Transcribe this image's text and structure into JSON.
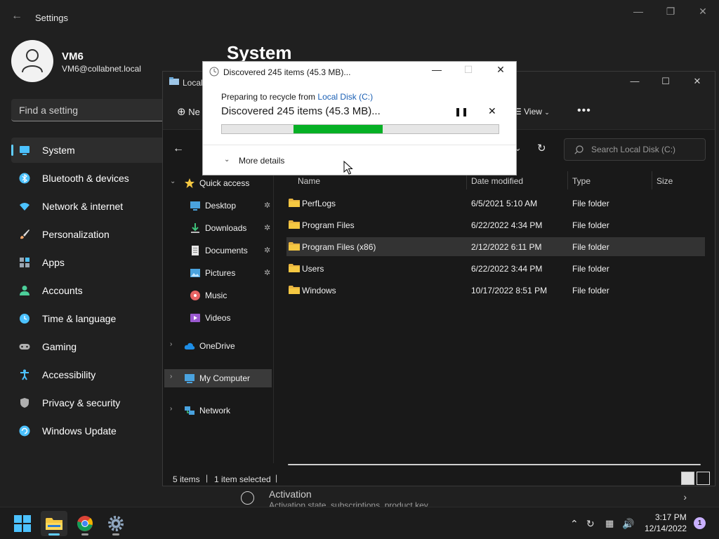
{
  "settings": {
    "title": "Settings",
    "user_name": "VM6",
    "user_email": "VM6@collabnet.local",
    "search_placeholder": "Find a setting",
    "page_heading": "System",
    "nav": [
      {
        "label": "System",
        "icon": "monitor-icon",
        "color": "#4cc2ff"
      },
      {
        "label": "Bluetooth & devices",
        "icon": "bluetooth-icon",
        "color": "#4cc2ff"
      },
      {
        "label": "Network & internet",
        "icon": "wifi-icon",
        "color": "#4cc2ff"
      },
      {
        "label": "Personalization",
        "icon": "brush-icon",
        "color": "#f7a86b"
      },
      {
        "label": "Apps",
        "icon": "apps-icon",
        "color": "#9aa6b2"
      },
      {
        "label": "Accounts",
        "icon": "person-icon",
        "color": "#4ccf9a"
      },
      {
        "label": "Time & language",
        "icon": "clock-globe-icon",
        "color": "#4cc2ff"
      },
      {
        "label": "Gaming",
        "icon": "gamepad-icon",
        "color": "#b0b0b0"
      },
      {
        "label": "Accessibility",
        "icon": "accessibility-icon",
        "color": "#4cc2ff"
      },
      {
        "label": "Privacy & security",
        "icon": "shield-icon",
        "color": "#b0b0b0"
      },
      {
        "label": "Windows Update",
        "icon": "update-icon",
        "color": "#4cc2ff"
      }
    ],
    "activation_title": "Activation",
    "activation_sub": "Activation state, subscriptions, product key"
  },
  "explorer": {
    "title": "Local",
    "new_label": "Ne",
    "view_label": "View",
    "search_placeholder": "Search Local Disk (C:)",
    "tree": [
      {
        "label": "Quick access",
        "icon": "star-icon",
        "level": 0,
        "expanded": true
      },
      {
        "label": "Desktop",
        "icon": "desktop-icon",
        "level": 1,
        "pinned": true
      },
      {
        "label": "Downloads",
        "icon": "download-icon",
        "level": 1,
        "pinned": true
      },
      {
        "label": "Documents",
        "icon": "document-icon",
        "level": 1,
        "pinned": true
      },
      {
        "label": "Pictures",
        "icon": "pictures-icon",
        "level": 1,
        "pinned": true
      },
      {
        "label": "Music",
        "icon": "music-icon",
        "level": 1
      },
      {
        "label": "Videos",
        "icon": "video-icon",
        "level": 1
      },
      {
        "label": "OneDrive",
        "icon": "cloud-icon",
        "level": 0
      },
      {
        "label": "My Computer",
        "icon": "computer-icon",
        "level": 0,
        "selected": true
      },
      {
        "label": "Network",
        "icon": "network-icon",
        "level": 0
      }
    ],
    "columns": [
      "Name",
      "Date modified",
      "Type",
      "Size"
    ],
    "files": [
      {
        "name": "PerfLogs",
        "date": "6/5/2021 5:10 AM",
        "type": "File folder"
      },
      {
        "name": "Program Files",
        "date": "6/22/2022 4:34 PM",
        "type": "File folder"
      },
      {
        "name": "Program Files (x86)",
        "date": "2/12/2022 6:11 PM",
        "type": "File folder",
        "selected": true
      },
      {
        "name": "Users",
        "date": "6/22/2022 3:44 PM",
        "type": "File folder"
      },
      {
        "name": "Windows",
        "date": "10/17/2022 8:51 PM",
        "type": "File folder"
      }
    ],
    "status_items": "5 items",
    "status_selected": "1 item selected"
  },
  "dialog": {
    "title": "Discovered 245 items (45.3 MB)...",
    "prep_prefix": "Preparing to recycle from ",
    "prep_location": "Local Disk (C:)",
    "main_text": "Discovered 245 items (45.3 MB)...",
    "progress_start": 0.26,
    "progress_end": 0.58,
    "more_details": "More details"
  },
  "taskbar": {
    "apps": [
      {
        "name": "start",
        "icon": "windows-logo-icon"
      },
      {
        "name": "file-explorer",
        "icon": "folder-icon",
        "active": true
      },
      {
        "name": "chrome",
        "icon": "chrome-icon"
      },
      {
        "name": "settings",
        "icon": "gear-icon"
      }
    ],
    "time": "3:17 PM",
    "date": "12/14/2022",
    "notification_count": "1"
  }
}
